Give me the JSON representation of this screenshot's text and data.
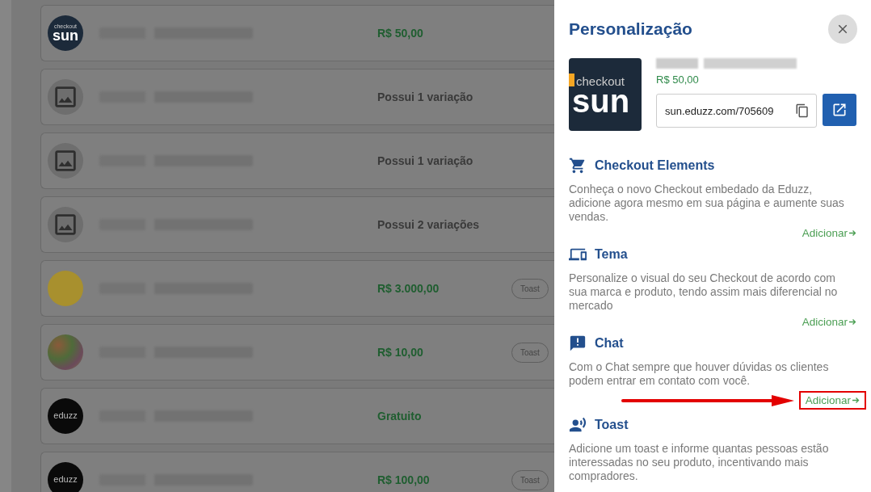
{
  "products": [
    {
      "avatar": {
        "kind": "sun",
        "top": "checkout",
        "bottom": "sun"
      },
      "value": {
        "kind": "price",
        "text": "R$ 50,00"
      }
    },
    {
      "avatar": {
        "kind": "image"
      },
      "value": {
        "kind": "variations",
        "text": "Possui 1 variação"
      }
    },
    {
      "avatar": {
        "kind": "image"
      },
      "value": {
        "kind": "variations",
        "text": "Possui 1 variação"
      }
    },
    {
      "avatar": {
        "kind": "image"
      },
      "value": {
        "kind": "variations",
        "text": "Possui 2 variações"
      }
    },
    {
      "avatar": {
        "kind": "yellow"
      },
      "value": {
        "kind": "price",
        "text": "R$ 3.000,00"
      },
      "badge": "Toast"
    },
    {
      "avatar": {
        "kind": "candy"
      },
      "value": {
        "kind": "price",
        "text": "R$ 10,00"
      },
      "badge": "Toast"
    },
    {
      "avatar": {
        "kind": "eduzz",
        "text": "eduzz"
      },
      "value": {
        "kind": "price",
        "text": "Gratuito"
      }
    },
    {
      "avatar": {
        "kind": "eduzz",
        "text": "eduzz"
      },
      "value": {
        "kind": "price",
        "text": "R$ 100,00"
      },
      "badge": "Toast"
    }
  ],
  "panel": {
    "title": "Personalização",
    "product": {
      "logo_top": "checkout",
      "logo_bottom": "sun",
      "price": "R$ 50,00",
      "link": "sun.eduzz.com/705609"
    },
    "sections": [
      {
        "kind": "cart",
        "title": "Checkout Elements",
        "description": "Conheça o novo Checkout embedado da Eduzz, adicione agora mesmo em sua página e aumente suas vendas.",
        "action": "Adicionar",
        "highlighted": false
      },
      {
        "kind": "devices",
        "title": "Tema",
        "description": "Personalize o visual do seu Checkout de acordo com sua marca e produto, tendo assim mais diferencial no mercado",
        "action": "Adicionar",
        "highlighted": false
      },
      {
        "kind": "chat",
        "title": "Chat",
        "description": "Com o Chat sempre que houver dúvidas os clientes podem entrar em contato com você.",
        "action": "Adicionar",
        "highlighted": true
      },
      {
        "kind": "toast",
        "title": "Toast",
        "description": "Adicione um toast e informe quantas pessoas estão interessadas no seu produto, incentivando mais compradores."
      }
    ]
  }
}
